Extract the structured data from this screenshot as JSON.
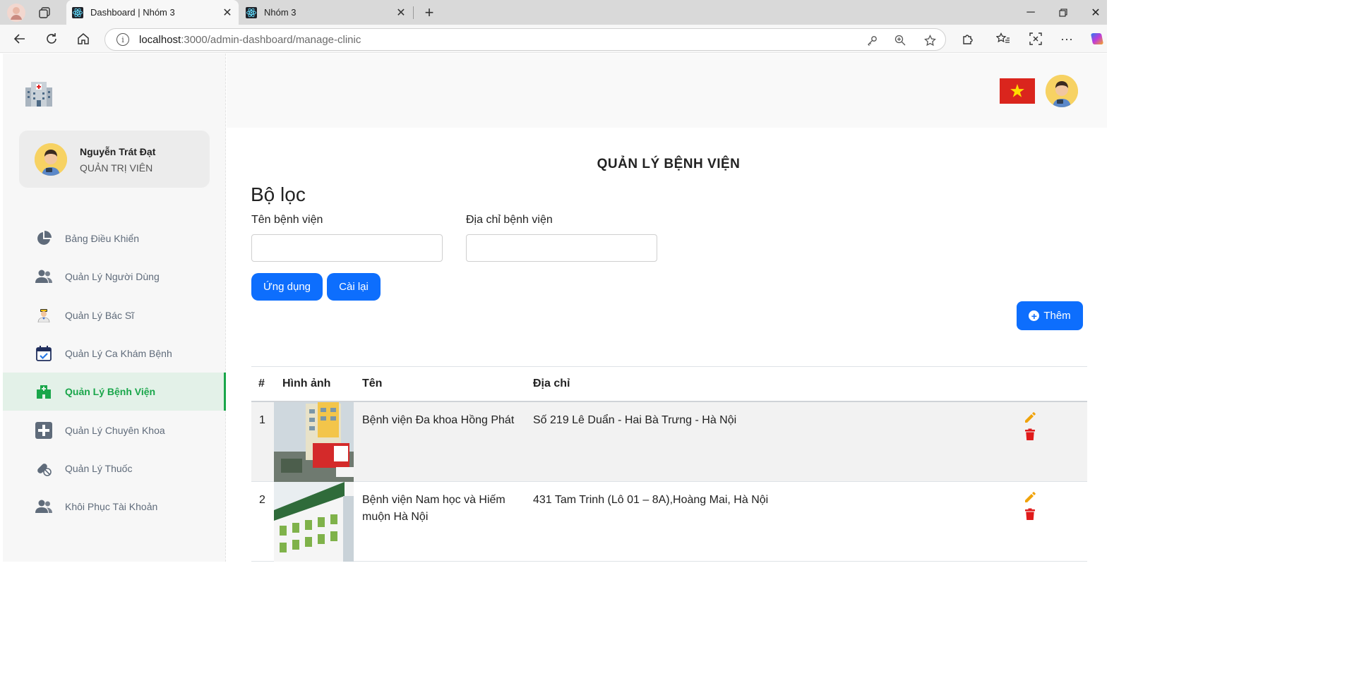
{
  "browser": {
    "tabs": [
      {
        "title": "Dashboard | Nhóm 3",
        "active": true
      },
      {
        "title": "Nhóm 3",
        "active": false
      }
    ],
    "url_host": "localhost",
    "url_path": ":3000/admin-dashboard/manage-clinic"
  },
  "sidebar": {
    "user": {
      "name": "Nguyễn Trát Đạt",
      "role": "QUẢN TRỊ VIÊN"
    },
    "items": [
      {
        "label": "Bảng Điều Khiển",
        "icon": "pie-chart-icon"
      },
      {
        "label": "Quản Lý Người Dùng",
        "icon": "users-icon"
      },
      {
        "label": "Quản Lý Bác Sĩ",
        "icon": "doctor-icon"
      },
      {
        "label": "Quản Lý Ca Khám Bệnh",
        "icon": "calendar-check-icon"
      },
      {
        "label": "Quản Lý Bệnh Viện",
        "icon": "hospital-icon",
        "active": true
      },
      {
        "label": "Quản Lý Chuyên Khoa",
        "icon": "medical-cross-icon"
      },
      {
        "label": "Quản Lý Thuốc",
        "icon": "pills-icon"
      },
      {
        "label": "Khôi Phục Tài Khoản",
        "icon": "users-restore-icon"
      }
    ]
  },
  "main": {
    "title": "QUẢN LÝ BỆNH VIỆN",
    "filter": {
      "heading": "Bộ lọc",
      "name_label": "Tên bệnh viện",
      "name_value": "",
      "address_label": "Địa chỉ bệnh viện",
      "address_value": "",
      "apply_label": "Ứng dụng",
      "reset_label": "Cài lại"
    },
    "add_label": "Thêm",
    "table": {
      "headers": [
        "#",
        "Hình ảnh",
        "Tên",
        "Địa chỉ"
      ],
      "rows": [
        {
          "index": "1",
          "name": "Bệnh viện Đa khoa Hồng Phát",
          "address": "Số 219 Lê Duẩn - Hai Bà Trưng - Hà Nội"
        },
        {
          "index": "2",
          "name": "Bệnh viện Nam học và Hiếm muộn Hà Nội",
          "address": "431 Tam Trinh (Lô 01 – 8A),Hoàng Mai, Hà Nội"
        }
      ]
    }
  },
  "colors": {
    "accent": "#0d6efd",
    "active_nav": "#19a64a",
    "edit": "#f0a30a",
    "delete": "#e01b1b"
  }
}
